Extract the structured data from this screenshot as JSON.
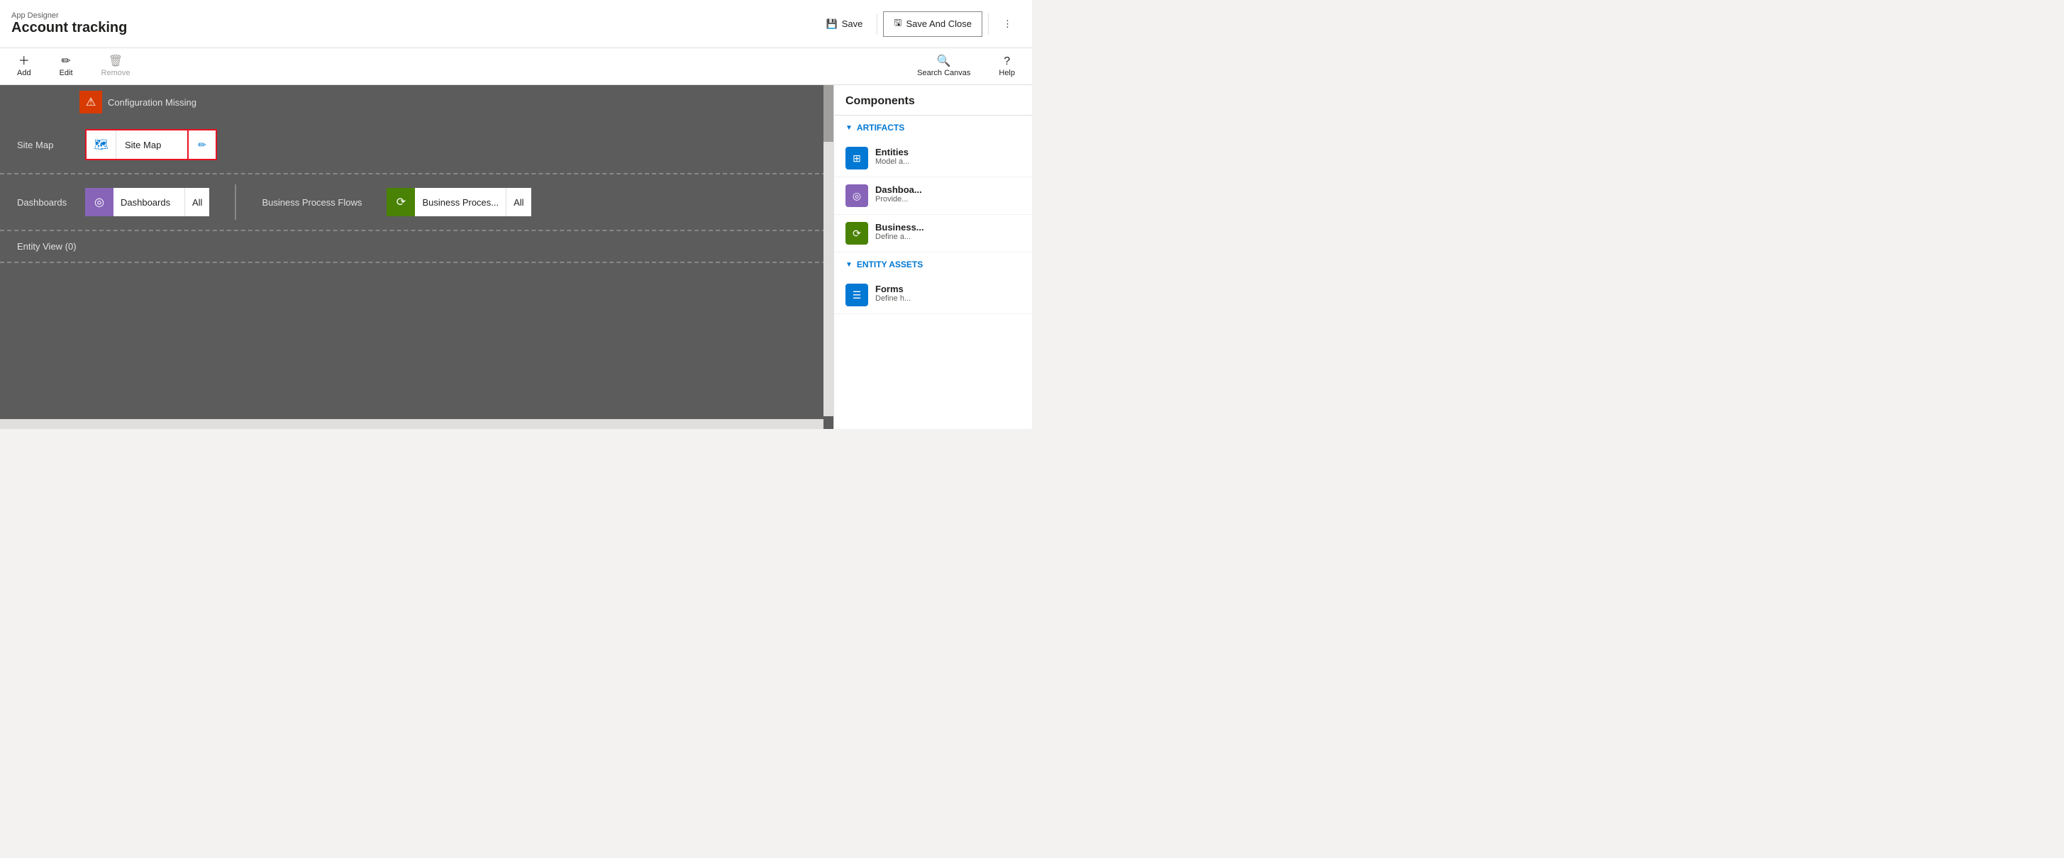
{
  "header": {
    "app_designer_label": "App Designer",
    "app_title": "Account tracking",
    "save_label": "Save",
    "save_close_label": "Save And Close"
  },
  "toolbar": {
    "add_label": "Add",
    "edit_label": "Edit",
    "remove_label": "Remove",
    "search_canvas_label": "Search Canvas",
    "help_label": "Help"
  },
  "canvas": {
    "site_map_row_label": "Site Map",
    "config_missing_text": "Configuration Missing",
    "site_map_card_label": "Site Map",
    "dashboards_row_label": "Dashboards",
    "dashboards_card_label": "Dashboards",
    "dashboards_all_label": "All",
    "bpf_section_label": "Business Process Flows",
    "bpf_card_label": "Business Proces...",
    "bpf_all_label": "All",
    "entity_view_label": "Entity View (0)"
  },
  "components_panel": {
    "title": "Components",
    "artifacts_section": "ARTIFACTS",
    "entity_assets_section": "ENTITY ASSETS",
    "items": [
      {
        "name": "Entities",
        "desc": "Model a...",
        "icon": "blue",
        "icon_char": "⊞"
      },
      {
        "name": "Dashboa...",
        "desc": "Provide...",
        "icon": "purple",
        "icon_char": "◎"
      },
      {
        "name": "Business...",
        "desc": "Define a...",
        "icon": "green",
        "icon_char": "⟳"
      }
    ],
    "entity_assets_items": [
      {
        "name": "Forms",
        "desc": "Define h...",
        "icon": "blue",
        "icon_char": "☰"
      }
    ]
  }
}
